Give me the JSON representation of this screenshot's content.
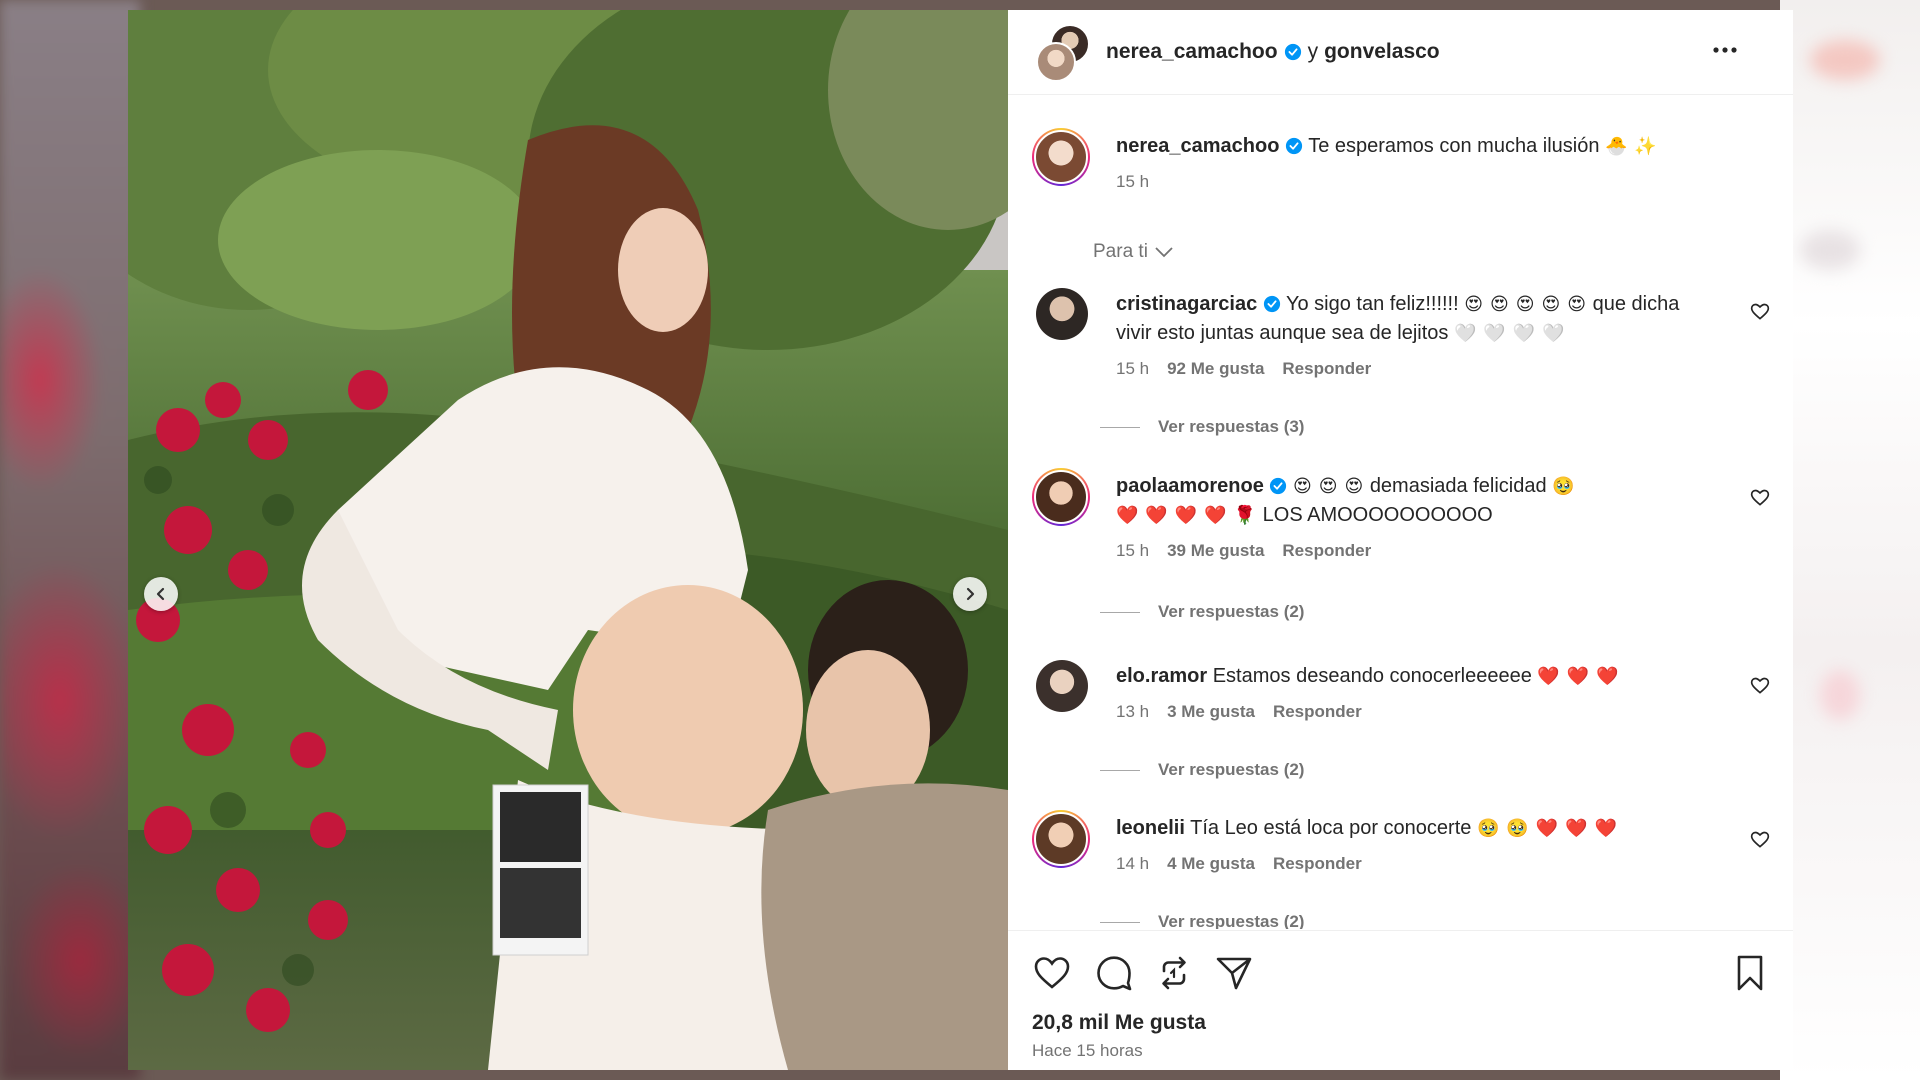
{
  "header": {
    "author": "nerea_camachoo",
    "connector": "y",
    "coauthor": "gonvelasco"
  },
  "caption": {
    "username": "nerea_camachoo",
    "text": "Te esperamos con mucha ilusión",
    "emojis": "🐣 ✨",
    "time": "15 h"
  },
  "filter": {
    "label": "Para ti"
  },
  "comments": [
    {
      "username": "cristinagarciac",
      "verified": true,
      "text_a": "Yo sigo tan feliz!!!!!!",
      "emojis_a": "😍 😍 😍 😍 😍",
      "text_b": "que dicha vivir esto juntas aunque sea de lejitos",
      "emojis_b": "🤍 🤍 🤍 🤍",
      "time": "15 h",
      "likes": "92 Me gusta",
      "reply": "Responder",
      "replies": "Ver respuestas (3)"
    },
    {
      "username": "paolaamorenoe",
      "verified": true,
      "emojis_a": "😍 😍 😍",
      "text_a": "demasiada felicidad",
      "emojis_b": "🥹",
      "emojis_c": "❤️ ❤️ ❤️ ❤️ 🌹",
      "text_b": "LOS AMOOOOOOOOOO",
      "time": "15 h",
      "likes": "39 Me gusta",
      "reply": "Responder",
      "replies": "Ver respuestas (2)"
    },
    {
      "username": "elo.ramor",
      "verified": false,
      "text_a": "Estamos deseando conocerleeeeee",
      "emojis_a": "❤️ ❤️ ❤️",
      "time": "13 h",
      "likes": "3 Me gusta",
      "reply": "Responder",
      "replies": "Ver respuestas (2)"
    },
    {
      "username": "leonelii",
      "verified": false,
      "text_a": "Tía Leo está loca por conocerte",
      "emojis_a": "🥹 🥹 ❤️ ❤️ ❤️",
      "time": "14 h",
      "likes": "4 Me gusta",
      "reply": "Responder",
      "replies": "Ver respuestas (2)"
    }
  ],
  "footer": {
    "likes": "20,8 mil Me gusta",
    "time_ago": "Hace 15 horas"
  },
  "icons": {
    "more": "more-options-icon",
    "like": "heart-icon",
    "comment": "comment-icon",
    "repost": "repost-icon",
    "share": "send-icon",
    "save": "bookmark-icon",
    "prev": "chevron-left-icon",
    "next": "chevron-right-icon",
    "verified": "verified-badge-icon"
  },
  "colors": {
    "text": "#262626",
    "secondary": "#737373",
    "verified": "#0095f6",
    "border": "#efefef"
  }
}
